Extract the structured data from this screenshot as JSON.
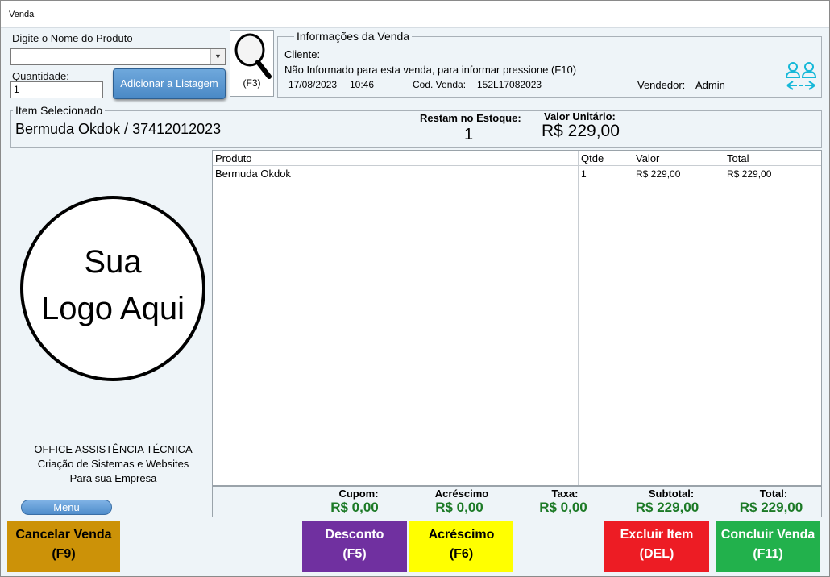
{
  "window": {
    "title": "Venda"
  },
  "product": {
    "search_label": "Digite o Nome do Produto",
    "search_value": "",
    "quantity_label": "Quantidade:",
    "quantity_value": "1",
    "add_button": "Adicionar a Listagem",
    "search_button_hotkey": "(F3)"
  },
  "sale_info": {
    "group_title": "Informações da Venda",
    "client_label": "Cliente:",
    "client_note": "Não Informado para esta venda, para informar pressione (F10)",
    "date": "17/08/2023",
    "time": "10:46",
    "code_label": "Cod. Venda:",
    "code_value": "152L17082023",
    "seller_label": "Vendedor:",
    "seller_value": "Admin"
  },
  "selected_item": {
    "group_title": "Item Selecionado",
    "name": "Bermuda  Okdok / 37412012023",
    "stock_label": "Restam no Estoque:",
    "stock_value": "1",
    "unit_price_label": "Valor Unitário:",
    "unit_price_value": "R$ 229,00"
  },
  "items_table": {
    "columns": [
      "Produto",
      "Qtde",
      "Valor",
      "Total"
    ],
    "rows": [
      {
        "produto": "Bermuda  Okdok",
        "qtde": "1",
        "valor": "R$ 229,00",
        "total": "R$ 229,00"
      }
    ]
  },
  "totals": {
    "cupom_label": "Cupom:",
    "cupom_value": "R$ 0,00",
    "acrescimo_label": "Acréscimo",
    "acrescimo_value": "R$ 0,00",
    "taxa_label": "Taxa:",
    "taxa_value": "R$ 0,00",
    "subtotal_label": "Subtotal:",
    "subtotal_value": "R$ 229,00",
    "total_label": "Total:",
    "total_value": "R$ 229,00"
  },
  "logo": {
    "line1": "Sua",
    "line2": "Logo Aqui"
  },
  "company": {
    "line1": "OFFICE ASSISTÊNCIA TÉCNICA",
    "line2": "Criação de Sistemas e Websites",
    "line3": "Para sua Empresa"
  },
  "menu_button": "Menu",
  "actions": {
    "cancel": {
      "label": "Cancelar Venda",
      "key": "(F9)",
      "color": "#cc9208"
    },
    "discount": {
      "label": "Desconto",
      "key": "(F5)",
      "color": "#7030a0"
    },
    "surcharge": {
      "label": "Acréscimo",
      "key": "(F6)",
      "color": "#ffff00"
    },
    "remove": {
      "label": "Excluir Item",
      "key": "(DEL)",
      "color": "#ed1c24"
    },
    "finish": {
      "label": "Concluir Venda",
      "key": "(F11)",
      "color": "#22b14c"
    }
  },
  "icons": {
    "search": "magnifier-icon",
    "client_switch": "users-swap-icon"
  }
}
